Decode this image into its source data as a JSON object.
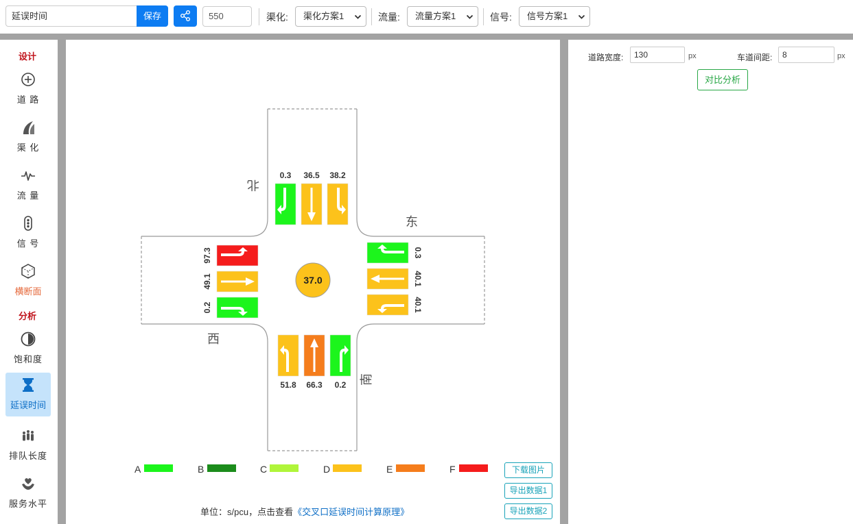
{
  "toolbar": {
    "name_value": "延误时间",
    "save_label": "保存",
    "number_value": "550",
    "channel_label": "渠化:",
    "channel_selected": "渠化方案1",
    "flow_label": "流量:",
    "flow_selected": "流量方案1",
    "signal_label": "信号:",
    "signal_selected": "信号方案1"
  },
  "sidebar": {
    "design_title": "设计",
    "analysis_title": "分析",
    "items": [
      {
        "label": "道 路",
        "icon": "road-crosshair-icon"
      },
      {
        "label": "渠 化",
        "icon": "channel-curve-icon"
      },
      {
        "label": "流 量",
        "icon": "pulse-icon"
      },
      {
        "label": "信 号",
        "icon": "traffic-light-icon"
      },
      {
        "label": "横断面",
        "icon": "cube-icon"
      },
      {
        "label": "饱和度",
        "icon": "half-circle-icon"
      },
      {
        "label": "延误时间",
        "icon": "hourglass-icon"
      },
      {
        "label": "排队长度",
        "icon": "people-queue-icon"
      },
      {
        "label": "服务水平",
        "icon": "hand-heart-icon"
      }
    ],
    "active_index": 6
  },
  "intersection": {
    "directions": {
      "north": "北",
      "east": "东",
      "west": "西",
      "south": "南"
    },
    "center_delay": "37.0",
    "center_color": "#fcc21b",
    "approaches": {
      "north": [
        {
          "movement": "right-turn",
          "delay": "0.3",
          "color": "#1cf51c"
        },
        {
          "movement": "through",
          "delay": "36.5",
          "color": "#fcc21b"
        },
        {
          "movement": "left-turn",
          "delay": "38.2",
          "color": "#fcc21b"
        }
      ],
      "west": [
        {
          "movement": "left-turn",
          "delay": "97.3",
          "color": "#f51c1c"
        },
        {
          "movement": "through",
          "delay": "49.1",
          "color": "#fcc21b"
        },
        {
          "movement": "right-turn",
          "delay": "0.2",
          "color": "#1cf51c"
        }
      ],
      "east": [
        {
          "movement": "right-turn",
          "delay": "0.3",
          "color": "#1cf51c"
        },
        {
          "movement": "through",
          "delay": "40.1",
          "color": "#fcc21b"
        },
        {
          "movement": "left-turn",
          "delay": "40.1",
          "color": "#fcc21b"
        }
      ],
      "south": [
        {
          "movement": "left-turn",
          "delay": "51.8",
          "color": "#fcc21b"
        },
        {
          "movement": "through",
          "delay": "66.3",
          "color": "#f57d1c"
        },
        {
          "movement": "right-turn",
          "delay": "0.2",
          "color": "#1cf51c"
        }
      ]
    }
  },
  "legend": [
    {
      "label": "A",
      "color": "#1cf51c"
    },
    {
      "label": "B",
      "color": "#1c8c1c"
    },
    {
      "label": "C",
      "color": "#b0f53a"
    },
    {
      "label": "D",
      "color": "#fcc21b"
    },
    {
      "label": "E",
      "color": "#f57d1c"
    },
    {
      "label": "F",
      "color": "#f51c1c"
    }
  ],
  "buttons": {
    "download_image": "下载图片",
    "export_data1": "导出数据1",
    "export_data2": "导出数据2"
  },
  "footer": {
    "unit_text": "单位：s/pcu，点击查看",
    "link_text": "《交叉口延误时间计算原理》"
  },
  "right_panel": {
    "road_width_label": "道路宽度:",
    "road_width_value": "130",
    "lane_spacing_label": "车道间距:",
    "lane_spacing_value": "8",
    "unit": "px",
    "compare_label": "对比分析"
  }
}
